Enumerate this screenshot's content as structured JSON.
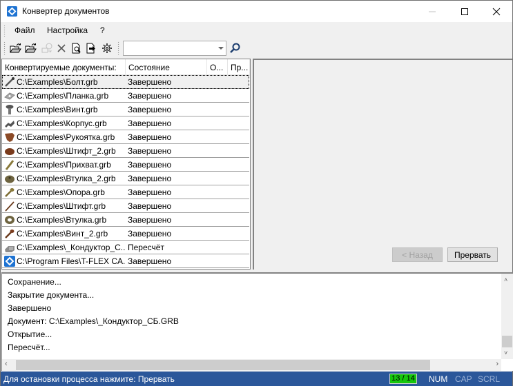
{
  "window": {
    "title": "Конвертер документов",
    "icons": {
      "app": "tflex-app-icon",
      "minimize": "minimize-icon",
      "maximize": "maximize-icon",
      "close": "close-icon"
    }
  },
  "menu": {
    "items": [
      {
        "label": "Файл"
      },
      {
        "label": "Настройка"
      },
      {
        "label": "?"
      }
    ]
  },
  "toolbar": {
    "buttons": [
      {
        "name": "open-folder",
        "icon": "open-folder-icon",
        "enabled": true
      },
      {
        "name": "open-folder-recursive",
        "icon": "open-folder-arrow-icon",
        "enabled": true
      },
      {
        "name": "convert",
        "icon": "convert-icon",
        "enabled": false
      },
      {
        "name": "delete",
        "icon": "delete-x-icon",
        "enabled": true
      },
      {
        "name": "preview",
        "icon": "preview-document-icon",
        "enabled": true
      },
      {
        "name": "export",
        "icon": "export-icon",
        "enabled": true
      },
      {
        "name": "settings",
        "icon": "gear-icon",
        "enabled": true
      }
    ],
    "search": {
      "value": "",
      "placeholder": ""
    }
  },
  "list": {
    "columns": [
      "Конвертируемые документы:",
      "Состояние",
      "О...",
      "Пр..."
    ],
    "rows": [
      {
        "path": "C:\\Examples\\Болт.grb",
        "state": "Завершено",
        "icon": "bolt-part-icon",
        "selected": true
      },
      {
        "path": "C:\\Examples\\Планка.grb",
        "state": "Завершено",
        "icon": "plate-part-icon"
      },
      {
        "path": "C:\\Examples\\Винт.grb",
        "state": "Завершено",
        "icon": "screw-part-icon"
      },
      {
        "path": "C:\\Examples\\Корпус.grb",
        "state": "Завершено",
        "icon": "housing-part-icon"
      },
      {
        "path": "C:\\Examples\\Рукоятка.grb",
        "state": "Завершено",
        "icon": "handle-part-icon"
      },
      {
        "path": "C:\\Examples\\Штифт_2.grb",
        "state": "Завершено",
        "icon": "pin2-part-icon"
      },
      {
        "path": "C:\\Examples\\Прихват.grb",
        "state": "Завершено",
        "icon": "clamp-part-icon"
      },
      {
        "path": "C:\\Examples\\Втулка_2.grb",
        "state": "Завершено",
        "icon": "bushing2-part-icon"
      },
      {
        "path": "C:\\Examples\\Опора.grb",
        "state": "Завершено",
        "icon": "support-part-icon"
      },
      {
        "path": "C:\\Examples\\Штифт.grb",
        "state": "Завершено",
        "icon": "pin-part-icon"
      },
      {
        "path": "C:\\Examples\\Втулка.grb",
        "state": "Завершено",
        "icon": "bushing-part-icon"
      },
      {
        "path": "C:\\Examples\\Винт_2.grb",
        "state": "Завершено",
        "icon": "screw2-part-icon"
      },
      {
        "path": "C:\\Examples\\_Кондуктор_С...",
        "state": "Пересчёт",
        "icon": "assembly-part-icon"
      },
      {
        "path": "C:\\Program Files\\T-FLEX CA...",
        "state": "Завершено",
        "icon": "tflex-app-icon"
      }
    ]
  },
  "wizard": {
    "back_label": "< Назад",
    "back_enabled": false,
    "abort_label": "Прервать"
  },
  "log": {
    "lines": [
      "Сохранение...",
      "Закрытие документа...",
      "Завершено",
      "Документ: C:\\Examples\\_Кондуктор_СБ.GRB",
      "Открытие...",
      "Пересчёт..."
    ]
  },
  "status": {
    "text": "Для остановки процесса нажмите: Прервать",
    "counter": "13 / 14",
    "indicators": {
      "num": "NUM",
      "cap": "CAP",
      "scrl": "SCRL"
    },
    "colors": {
      "bar": "#2b579a",
      "counter": "#16c60c",
      "inactive": "#9cb2d6"
    }
  }
}
